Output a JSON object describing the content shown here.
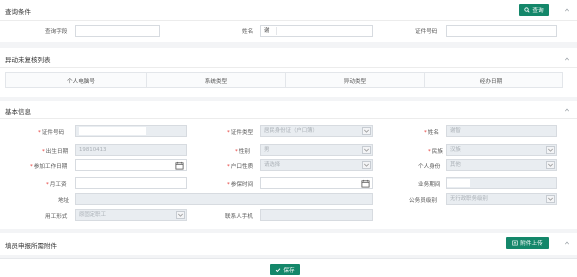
{
  "query_panel": {
    "title": "查询条件",
    "search_button": "查询",
    "fields": [
      {
        "label": "查询字段",
        "value": ""
      },
      {
        "label": "姓名",
        "value": "谢"
      },
      {
        "label": "证件号码",
        "value": ""
      }
    ]
  },
  "review_panel": {
    "title": "异动未复核列表",
    "columns": [
      "个人电脑号",
      "系统类型",
      "异动类型",
      "经办日期"
    ]
  },
  "basic_panel": {
    "title": "基本信息",
    "fields": {
      "id_no": {
        "label": "证件号码",
        "value": ""
      },
      "id_type": {
        "label": "证件类型",
        "value": "居民身份证（户口簿）"
      },
      "name": {
        "label": "姓名",
        "value": "谢智"
      },
      "birth_date": {
        "label": "出生日期",
        "value": "19810413"
      },
      "gender": {
        "label": "性别",
        "value": "男"
      },
      "ethnicity": {
        "label": "民族",
        "value": "汉族"
      },
      "work_start_date": {
        "label": "参加工作日期",
        "value": ""
      },
      "hukou_type": {
        "label": "户口性质",
        "value": "请选择"
      },
      "personal_status": {
        "label": "个人身份",
        "value": "其他"
      },
      "monthly_salary": {
        "label": "月工资",
        "value": ""
      },
      "insured_time": {
        "label": "参保时间",
        "value": ""
      },
      "business_period": {
        "label": "业务期间",
        "value": ""
      },
      "address": {
        "label": "地址",
        "value": ""
      },
      "civil_servant_level": {
        "label": "公务员级别",
        "value": "无行政职务级别"
      },
      "employment_form": {
        "label": "用工形式",
        "value": "原固定职工"
      },
      "contact_phone": {
        "label": "联系人手机",
        "value": ""
      }
    }
  },
  "attachment_panel": {
    "title": "填员申报所需附件",
    "upload_button": "附件上传"
  },
  "footer": {
    "save_button": "保存"
  },
  "colors": {
    "accent_green": "#14876a",
    "required_red": "#e53935"
  }
}
